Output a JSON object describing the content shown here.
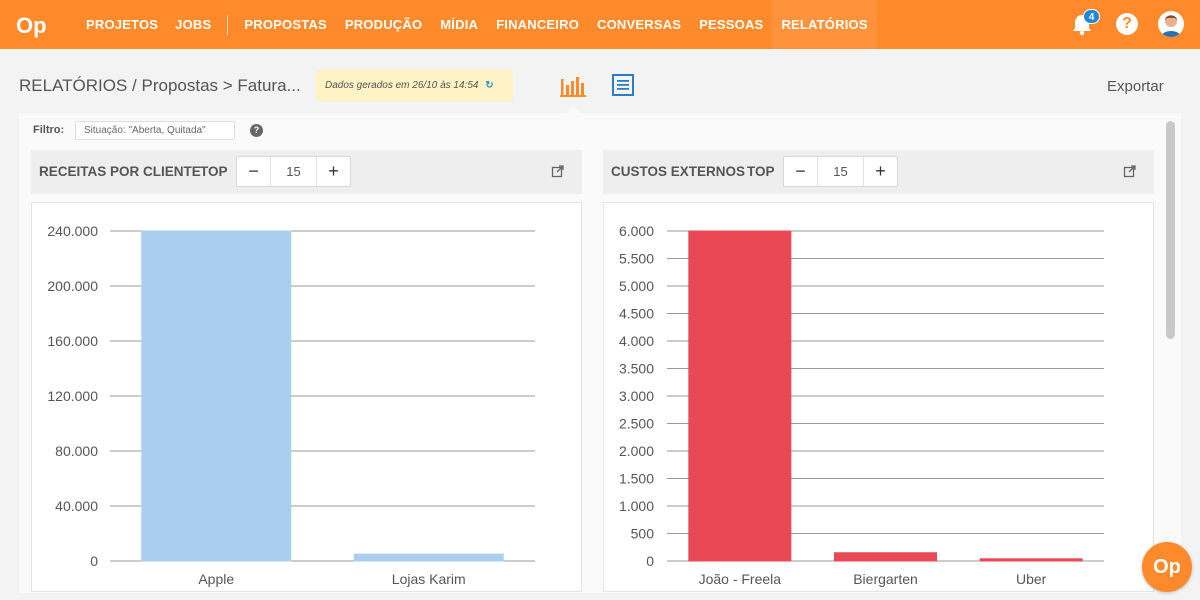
{
  "nav": {
    "logo": "Op",
    "items": [
      {
        "label": "PROJETOS",
        "active": false
      },
      {
        "label": "JOBS",
        "active": false
      },
      {
        "label": "PROPOSTAS",
        "active": false
      },
      {
        "label": "PRODUÇÃO",
        "active": false
      },
      {
        "label": "MÍDIA",
        "active": false
      },
      {
        "label": "FINANCEIRO",
        "active": false
      },
      {
        "label": "CONVERSAS",
        "active": false
      },
      {
        "label": "PESSOAS",
        "active": false
      },
      {
        "label": "RELATÓRIOS",
        "active": true
      }
    ],
    "notifications": "4",
    "help": "?"
  },
  "header": {
    "breadcrumb": "RELATÓRIOS / Propostas > Fatura...",
    "generated": "Dados gerados em 26/10 às 14:54",
    "refresh_icon": "↻",
    "export_label": "Exportar"
  },
  "filter": {
    "label": "Filtro:",
    "value": "Situação: \"Aberta, Quitada\"",
    "help": "?"
  },
  "widgets": {
    "left": {
      "title": "RECEITAS POR CLIENTE",
      "top_label": "TOP",
      "top_value": "15",
      "minus": "−",
      "plus": "+"
    },
    "right": {
      "title": "CUSTOS EXTERNOS",
      "top_label": "TOP",
      "top_value": "15",
      "minus": "−",
      "plus": "+"
    }
  },
  "fab_label": "Op",
  "colors": {
    "brand": "#fe8a2b",
    "receitas": "#aacfee",
    "custos": "#e84955"
  },
  "chart_data": [
    {
      "type": "bar",
      "title": "RECEITAS POR CLIENTE",
      "categories": [
        "Apple",
        "Lojas Karim"
      ],
      "values": [
        240000,
        5000
      ],
      "ylim": [
        0,
        240000
      ],
      "yticks": [
        0,
        40000,
        80000,
        120000,
        160000,
        200000,
        240000
      ],
      "ytick_labels": [
        "0",
        "40.000",
        "80.000",
        "120.000",
        "160.000",
        "200.000",
        "240.000"
      ],
      "grid": true
    },
    {
      "type": "bar",
      "title": "CUSTOS EXTERNOS",
      "categories": [
        "João - Freela",
        "Biergarten",
        "Uber"
      ],
      "values": [
        6000,
        150,
        40
      ],
      "ylim": [
        0,
        6000
      ],
      "yticks": [
        0,
        500,
        1000,
        1500,
        2000,
        2500,
        3000,
        3500,
        4000,
        4500,
        5000,
        5500,
        6000
      ],
      "ytick_labels": [
        "0",
        "500",
        "1.000",
        "1.500",
        "2.000",
        "2.500",
        "3.000",
        "3.500",
        "4.000",
        "4.500",
        "5.000",
        "5.500",
        "6.000"
      ],
      "grid": true
    }
  ]
}
